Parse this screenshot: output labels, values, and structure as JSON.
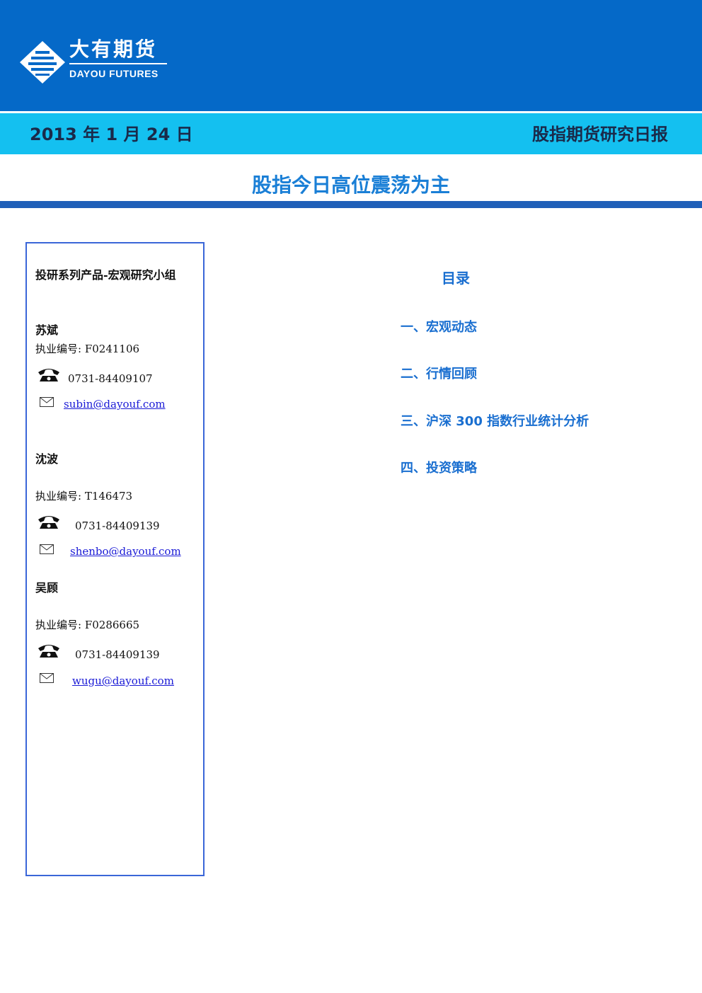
{
  "brand": {
    "name_cn": "大有期货",
    "name_en": "DAYOU FUTURES",
    "color_primary": "#0569c8",
    "color_band": "#14c0f0"
  },
  "header": {
    "date": "2013 年 1 月 24 日",
    "report_type": "股指期货研究日报"
  },
  "headline": "股指今日高位震荡为主",
  "contacts": {
    "group_title": "投研系列产品-宏观研究小组",
    "people": [
      {
        "name": "苏斌",
        "license": "执业编号: F0241106",
        "phone": "0731-84409107",
        "email": "subin@dayouf.com"
      },
      {
        "name": "沈波",
        "license": "执业编号: T146473",
        "phone": "0731-84409139",
        "email": "shenbo@dayouf.com"
      },
      {
        "name": "吴顾",
        "license": "执业编号: F0286665",
        "phone": "0731-84409139",
        "email": "wugu@dayouf.com"
      }
    ]
  },
  "toc": {
    "title": "目录",
    "items": [
      "一、宏观动态",
      "二、行情回顾",
      "三、沪深 300 指数行业统计分析",
      "四、投资策略"
    ]
  }
}
